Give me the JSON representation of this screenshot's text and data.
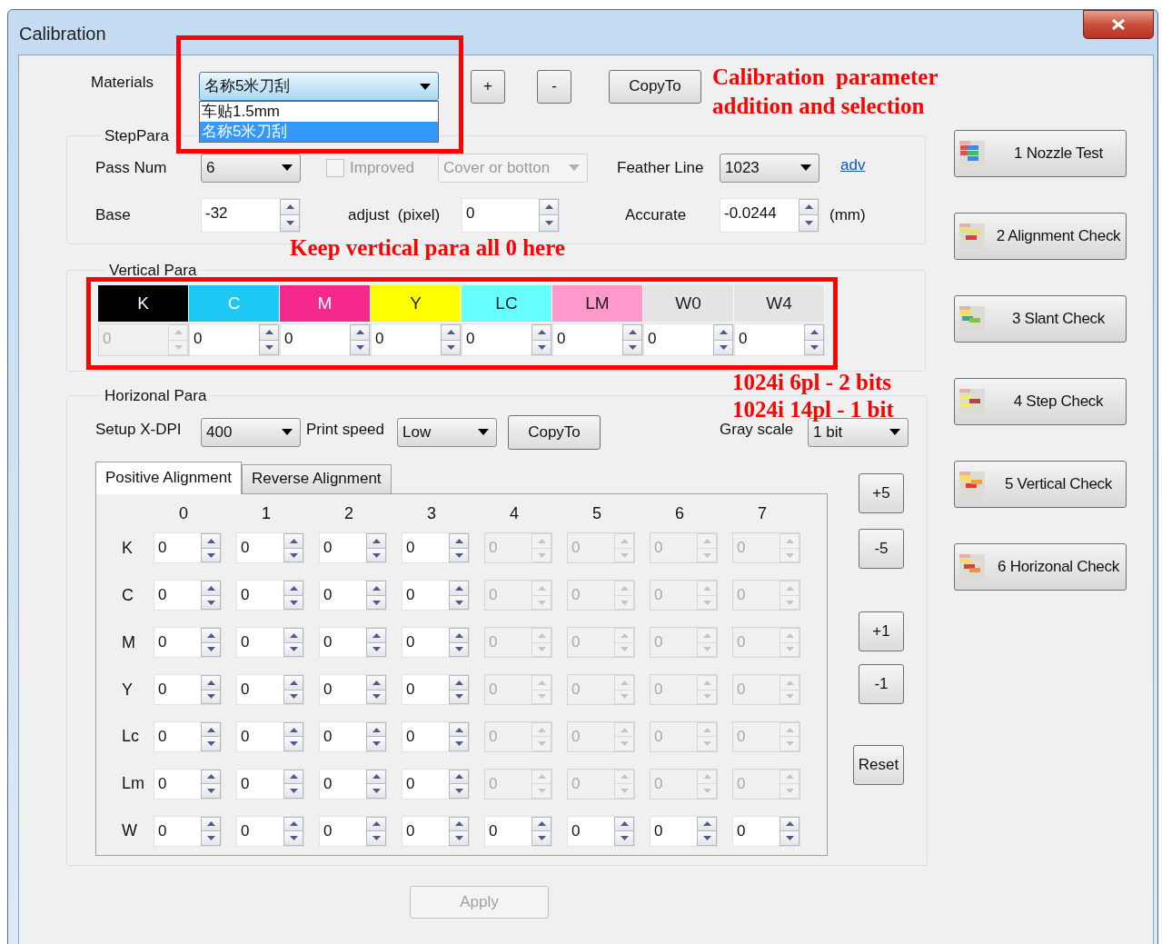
{
  "window": {
    "title": "Calibration"
  },
  "materials": {
    "label": "Materials",
    "value": "名称5米刀刮",
    "expanded": true,
    "options": [
      {
        "label": "车贴1.5mm",
        "selected": false
      },
      {
        "label": "名称5米刀刮",
        "selected": true
      }
    ],
    "buttons": [
      "+",
      "-",
      "CopyTo"
    ]
  },
  "annotations": {
    "materials": [
      "Calibration  parameter",
      "addition and selection"
    ],
    "vertical": "Keep vertical para all 0 here",
    "gray_scale": [
      "1024i 6pl - 2 bits",
      "1024i 14pl - 1 bit"
    ]
  },
  "step_para": {
    "title": "StepPara",
    "pass_num": {
      "label": "Pass Num",
      "value": "6"
    },
    "improved": {
      "label": "Improved",
      "checked": false,
      "disabled": true
    },
    "cover": {
      "value": "Cover or botton",
      "disabled": true
    },
    "feather_line": {
      "label": "Feather Line",
      "value": "1023"
    },
    "adv_link": "adv",
    "base": {
      "label": "Base",
      "value": "-32"
    },
    "adjust": {
      "label": "adjust  (pixel)",
      "value": "0"
    },
    "accurate": {
      "label": "Accurate",
      "value": "-0.0244",
      "unit": "(mm)"
    }
  },
  "vertical_para": {
    "title": "Vertical Para",
    "channels": [
      {
        "name": "K",
        "color": "#000000",
        "value": "0",
        "disabled": true
      },
      {
        "name": "C",
        "color": "#1ec8f5",
        "value": "0",
        "disabled": false
      },
      {
        "name": "M",
        "color": "#f5288c",
        "value": "0",
        "disabled": false
      },
      {
        "name": "Y",
        "color": "#ffff00",
        "value": "0",
        "disabled": false
      },
      {
        "name": "LC",
        "color": "#66ffff",
        "value": "0",
        "disabled": false
      },
      {
        "name": "LM",
        "color": "#ff99cc",
        "value": "0",
        "disabled": false
      },
      {
        "name": "W0",
        "color": "#e4e4e4",
        "value": "0",
        "disabled": false
      },
      {
        "name": "W4",
        "color": "#e4e4e4",
        "value": "0",
        "disabled": false
      }
    ]
  },
  "horizontal_para": {
    "title": "Horizonal Para",
    "x_dpi": {
      "label": "Setup X-DPI",
      "value": "400"
    },
    "print_speed": {
      "label": "Print speed",
      "value": "Low"
    },
    "copy_button": "CopyTo",
    "gray_scale": {
      "label": "Gray scale",
      "value": "1 bit"
    },
    "tabs": [
      {
        "label": "Positive Alignment",
        "selected": true
      },
      {
        "label": "Reverse Alignment",
        "selected": false
      }
    ],
    "columns": [
      "0",
      "1",
      "2",
      "3",
      "4",
      "5",
      "6",
      "7"
    ],
    "rows": [
      {
        "label": "K",
        "cells": [
          {
            "value": "0",
            "disabled": false
          },
          {
            "value": "0",
            "disabled": false
          },
          {
            "value": "0",
            "disabled": false
          },
          {
            "value": "0",
            "disabled": false
          },
          {
            "value": "0",
            "disabled": true
          },
          {
            "value": "0",
            "disabled": true
          },
          {
            "value": "0",
            "disabled": true
          },
          {
            "value": "0",
            "disabled": true
          }
        ]
      },
      {
        "label": "C",
        "cells": [
          {
            "value": "0",
            "disabled": false
          },
          {
            "value": "0",
            "disabled": false
          },
          {
            "value": "0",
            "disabled": false
          },
          {
            "value": "0",
            "disabled": false
          },
          {
            "value": "0",
            "disabled": true
          },
          {
            "value": "0",
            "disabled": true
          },
          {
            "value": "0",
            "disabled": true
          },
          {
            "value": "0",
            "disabled": true
          }
        ]
      },
      {
        "label": "M",
        "cells": [
          {
            "value": "0",
            "disabled": false
          },
          {
            "value": "0",
            "disabled": false
          },
          {
            "value": "0",
            "disabled": false
          },
          {
            "value": "0",
            "disabled": false
          },
          {
            "value": "0",
            "disabled": true
          },
          {
            "value": "0",
            "disabled": true
          },
          {
            "value": "0",
            "disabled": true
          },
          {
            "value": "0",
            "disabled": true
          }
        ]
      },
      {
        "label": "Y",
        "cells": [
          {
            "value": "0",
            "disabled": false
          },
          {
            "value": "0",
            "disabled": false
          },
          {
            "value": "0",
            "disabled": false
          },
          {
            "value": "0",
            "disabled": false
          },
          {
            "value": "0",
            "disabled": true
          },
          {
            "value": "0",
            "disabled": true
          },
          {
            "value": "0",
            "disabled": true
          },
          {
            "value": "0",
            "disabled": true
          }
        ]
      },
      {
        "label": "Lc",
        "cells": [
          {
            "value": "0",
            "disabled": false
          },
          {
            "value": "0",
            "disabled": false
          },
          {
            "value": "0",
            "disabled": false
          },
          {
            "value": "0",
            "disabled": false
          },
          {
            "value": "0",
            "disabled": true
          },
          {
            "value": "0",
            "disabled": true
          },
          {
            "value": "0",
            "disabled": true
          },
          {
            "value": "0",
            "disabled": true
          }
        ]
      },
      {
        "label": "Lm",
        "cells": [
          {
            "value": "0",
            "disabled": false
          },
          {
            "value": "0",
            "disabled": false
          },
          {
            "value": "0",
            "disabled": false
          },
          {
            "value": "0",
            "disabled": false
          },
          {
            "value": "0",
            "disabled": true
          },
          {
            "value": "0",
            "disabled": true
          },
          {
            "value": "0",
            "disabled": true
          },
          {
            "value": "0",
            "disabled": true
          }
        ]
      },
      {
        "label": "W",
        "cells": [
          {
            "value": "0",
            "disabled": false
          },
          {
            "value": "0",
            "disabled": false
          },
          {
            "value": "0",
            "disabled": false
          },
          {
            "value": "0",
            "disabled": false
          },
          {
            "value": "0",
            "disabled": false
          },
          {
            "value": "0",
            "disabled": false
          },
          {
            "value": "0",
            "disabled": false
          },
          {
            "value": "0",
            "disabled": false
          }
        ]
      }
    ],
    "step_buttons": [
      "+5",
      "-5",
      "+1",
      "-1"
    ],
    "reset_button": "Reset"
  },
  "check_buttons": [
    "1 Nozzle Test",
    "2 Alignment Check",
    "3 Slant Check",
    "4 Step Check",
    "5 Vertical Check",
    "6 Horizonal Check"
  ],
  "apply_button": {
    "label": "Apply",
    "disabled": true
  }
}
